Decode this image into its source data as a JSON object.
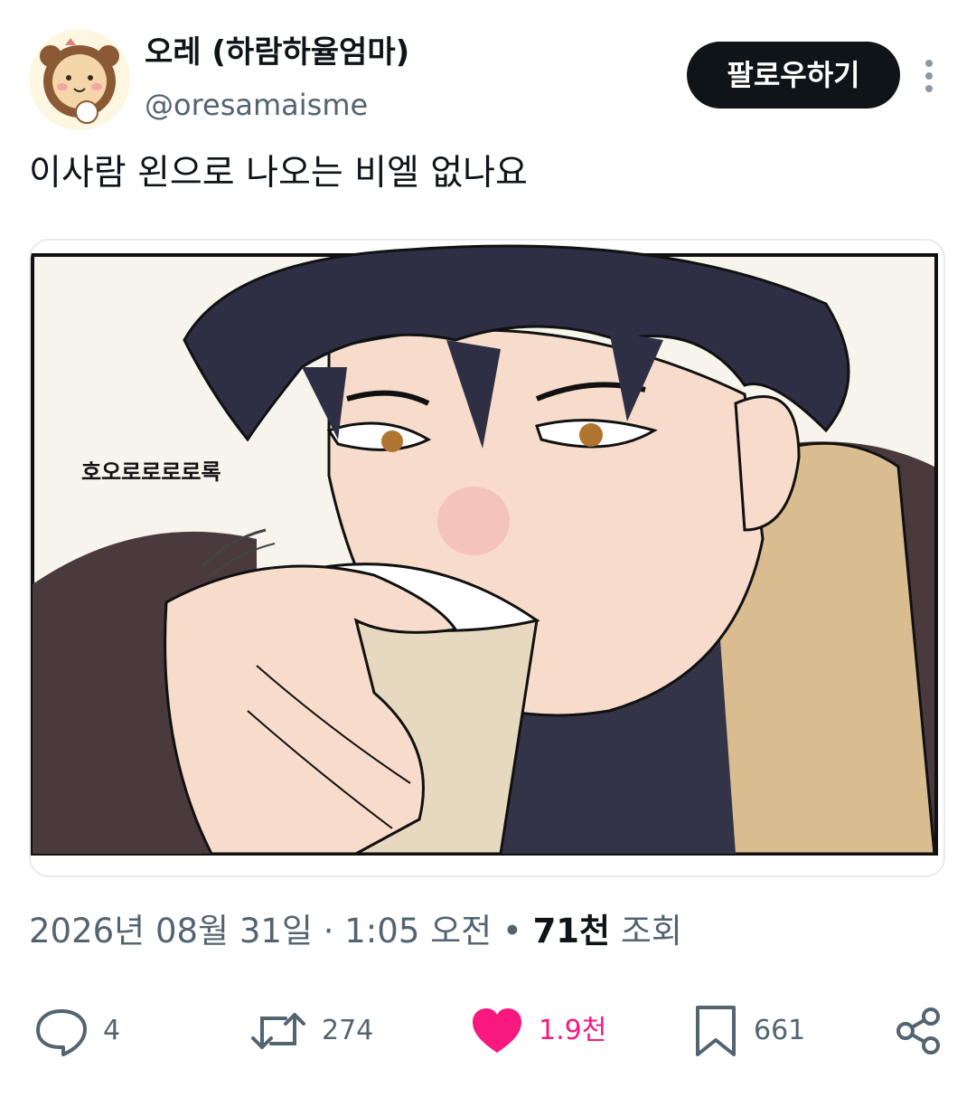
{
  "user": {
    "display_name": "오레 (하람하율엄마)",
    "handle": "@oresamaisme",
    "follow_label": "팔로우하기"
  },
  "tweet": {
    "text": "이사람 왼으로 나오는 비엘 없나요",
    "image_caption": "호오로로로로록"
  },
  "meta": {
    "date": "2026년 08월 31일",
    "sep1": " · ",
    "time": "1:05 오전",
    "sep2": " • ",
    "views_count": "71천",
    "views_label": " 조회"
  },
  "actions": {
    "reply": {
      "icon": "reply-icon",
      "count": "4"
    },
    "retweet": {
      "icon": "retweet-icon",
      "count": "274"
    },
    "like": {
      "icon": "heart-icon",
      "count": "1.9천",
      "active": true
    },
    "bookmark": {
      "icon": "bookmark-icon",
      "count": "661"
    },
    "share": {
      "icon": "share-icon"
    }
  },
  "colors": {
    "accent_like": "#f91880",
    "text_primary": "#0f1419",
    "text_secondary": "#536471",
    "button_bg": "#0f1419"
  }
}
